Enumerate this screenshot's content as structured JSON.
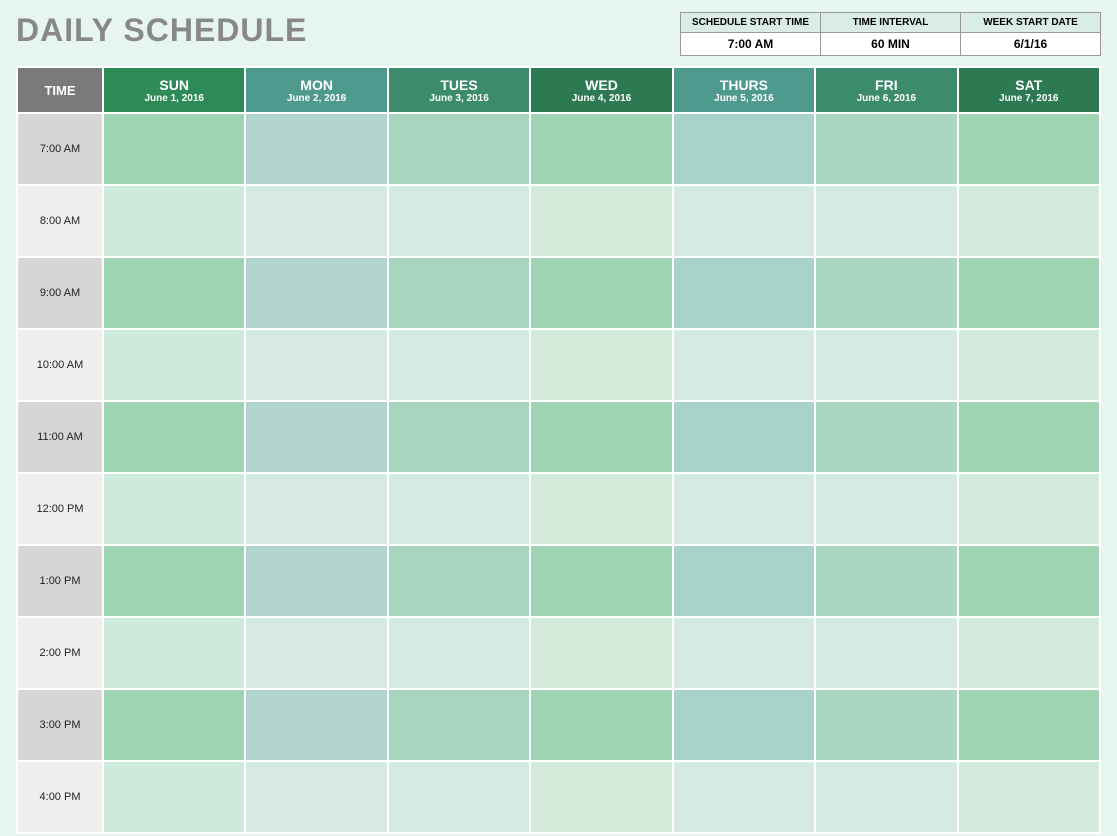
{
  "title": "DAILY SCHEDULE",
  "config": {
    "headers": {
      "start_time": "SCHEDULE START TIME",
      "interval": "TIME INTERVAL",
      "week_start": "WEEK START DATE"
    },
    "values": {
      "start_time": "7:00 AM",
      "interval": "60 MIN",
      "week_start": "6/1/16"
    }
  },
  "schedule": {
    "time_header": "TIME",
    "days": [
      {
        "key": "sun",
        "name": "SUN",
        "date": "June 1, 2016"
      },
      {
        "key": "mon",
        "name": "MON",
        "date": "June 2, 2016"
      },
      {
        "key": "tues",
        "name": "TUES",
        "date": "June 3, 2016"
      },
      {
        "key": "wed",
        "name": "WED",
        "date": "June 4, 2016"
      },
      {
        "key": "thurs",
        "name": "THURS",
        "date": "June 5, 2016"
      },
      {
        "key": "fri",
        "name": "FRI",
        "date": "June 6, 2016"
      },
      {
        "key": "sat",
        "name": "SAT",
        "date": "June 7, 2016"
      }
    ],
    "times": [
      "7:00 AM",
      "8:00 AM",
      "9:00 AM",
      "10:00 AM",
      "11:00 AM",
      "12:00 PM",
      "1:00 PM",
      "2:00 PM",
      "3:00 PM",
      "4:00 PM"
    ]
  }
}
